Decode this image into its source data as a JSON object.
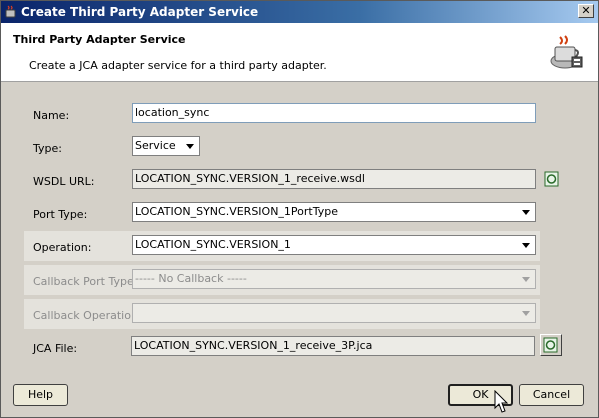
{
  "window": {
    "title": "Create Third Party Adapter Service",
    "close_glyph": "✕"
  },
  "header": {
    "title": "Third Party Adapter Service",
    "description": "Create a JCA adapter service for a third party adapter.",
    "icon": "coffee-cup-adapter-icon"
  },
  "form": {
    "name": {
      "label": "Name:",
      "value": "location_sync"
    },
    "type": {
      "label": "Type:",
      "value": "Service"
    },
    "wsdl_url": {
      "label": "WSDL URL:",
      "value": "LOCATION_SYNC.VERSION_1_receive.wsdl"
    },
    "port_type": {
      "label": "Port Type:",
      "value": "LOCATION_SYNC.VERSION_1PortType"
    },
    "operation": {
      "label": "Operation:",
      "value": "LOCATION_SYNC.VERSION_1"
    },
    "callback_port_type": {
      "label": "Callback Port Type:",
      "value": "----- No Callback -----"
    },
    "callback_operation": {
      "label": "Callback Operation:",
      "value": ""
    },
    "jca_file": {
      "label": "JCA File:",
      "value": "LOCATION_SYNC.VERSION_1_receive_3P.jca"
    }
  },
  "buttons": {
    "help": "Help",
    "ok": "OK",
    "cancel": "Cancel"
  },
  "colors": {
    "title_bar_start": "#0a246a",
    "title_bar_end": "#a6caf0",
    "dialog_bg": "#d4d0c8",
    "field_border": "#7f9db9"
  }
}
